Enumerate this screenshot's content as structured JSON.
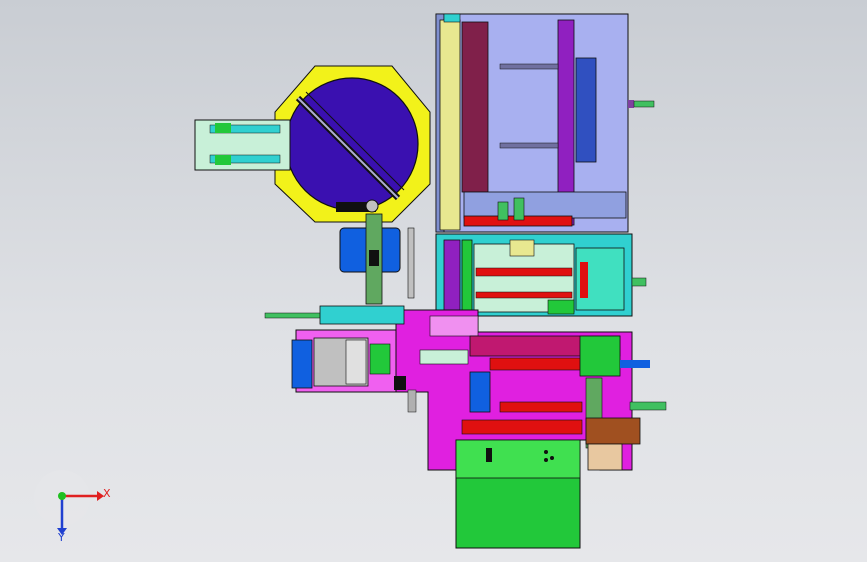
{
  "view": {
    "background_top": "#c9cdd3",
    "background_bottom": "#e6e7ea"
  },
  "triad": {
    "x_label": "X",
    "y_label": "Y",
    "x_color": "#e02020",
    "y_color": "#2040d0",
    "origin_color": "#20c020"
  },
  "colors": {
    "magenta": "#e020e0",
    "purple": "#3a10b0",
    "yellow": "#f2f21a",
    "green": "#22c83a",
    "cyan": "#30d0d0",
    "blue": "#1060e0",
    "red": "#e01010",
    "maroon": "#80204a",
    "lavender": "#a8b0f0",
    "mint": "#c8f0d8",
    "outline": "#101010"
  }
}
